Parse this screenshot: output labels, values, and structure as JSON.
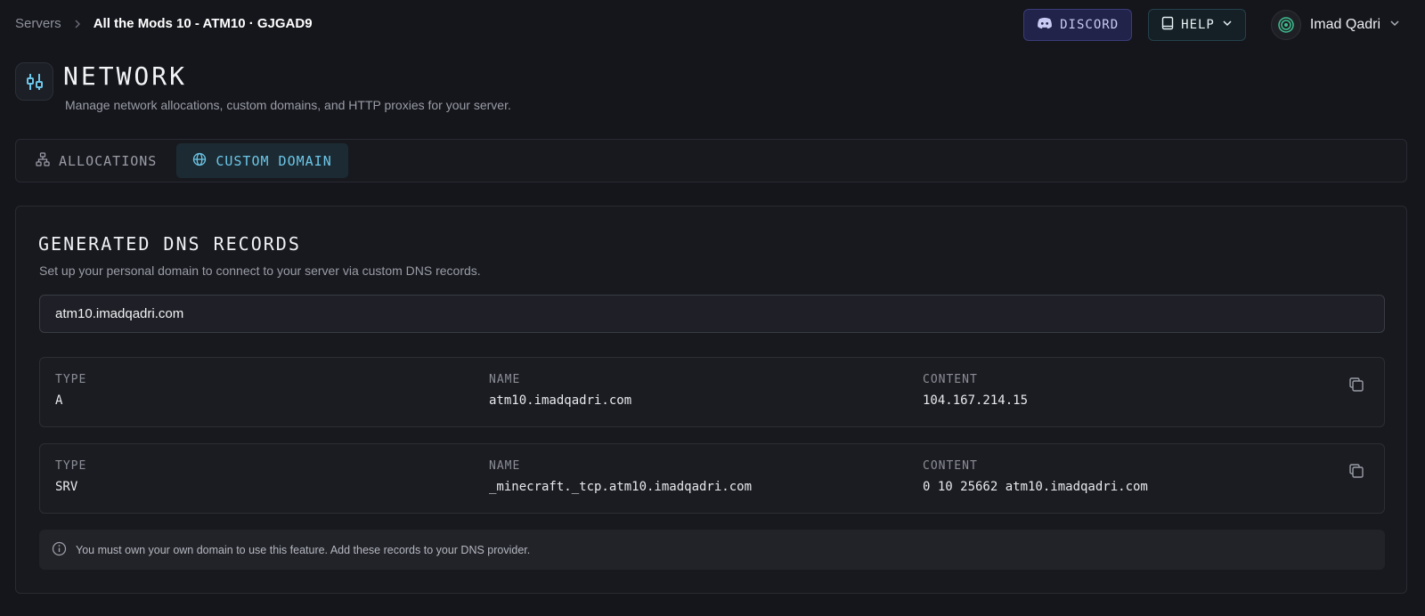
{
  "breadcrumb": {
    "root": "Servers",
    "current": "All the Mods 10 - ATM10 · GJGAD9"
  },
  "top_actions": {
    "discord_label": "DISCORD",
    "help_label": "HELP",
    "user_name": "Imad Qadri"
  },
  "header": {
    "title": "NETWORK",
    "subtitle": "Manage network allocations, custom domains, and HTTP proxies for your server."
  },
  "tabs": [
    {
      "label": "ALLOCATIONS",
      "active": false
    },
    {
      "label": "CUSTOM DOMAIN",
      "active": true
    }
  ],
  "dns": {
    "title": "GENERATED DNS RECORDS",
    "description": "Set up your personal domain to connect to your server via custom DNS records.",
    "domain_value": "atm10.imadqadri.com",
    "columns": {
      "type": "TYPE",
      "name": "NAME",
      "content": "CONTENT"
    },
    "records": [
      {
        "type": "A",
        "name": "atm10.imadqadri.com",
        "content": "104.167.214.15"
      },
      {
        "type": "SRV",
        "name": "_minecraft._tcp.atm10.imadqadri.com",
        "content": "0 10 25662 atm10.imadqadri.com"
      }
    ],
    "notice": "You must own your own domain to use this feature. Add these records to your DNS provider."
  },
  "colors": {
    "background": "#15161c",
    "accent": "#6cc6e8",
    "discord": "#22234a"
  },
  "icons": [
    "chevron-right-icon",
    "discord-icon",
    "book-icon",
    "chevron-down-icon",
    "network-icon",
    "sitemap-icon",
    "globe-icon",
    "copy-icon",
    "info-icon"
  ]
}
